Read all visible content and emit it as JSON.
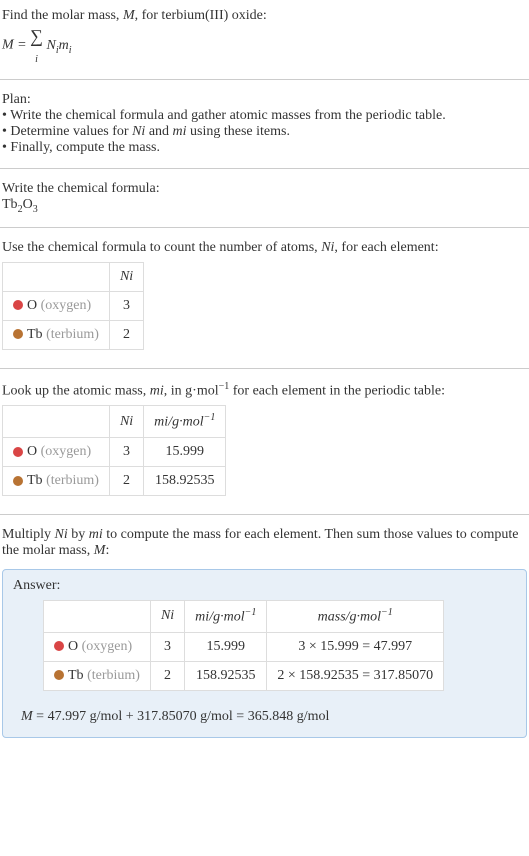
{
  "intro": {
    "line1": "Find the molar mass, ",
    "var_m": "M",
    "line1b": ", for terbium(III) oxide:",
    "formula_prefix": "M = ",
    "formula_body": "Nᵢmᵢ"
  },
  "plan": {
    "title": "Plan:",
    "bullet1": "• Write the chemical formula and gather atomic masses from the periodic table.",
    "bullet2_a": "• Determine values for ",
    "bullet2_ni": "Nᵢ",
    "bullet2_b": " and ",
    "bullet2_mi": "mᵢ",
    "bullet2_c": " using these items.",
    "bullet3": "• Finally, compute the mass."
  },
  "chem": {
    "title": "Write the chemical formula:",
    "formula_tb": "Tb",
    "formula_tb_sub": "2",
    "formula_o": "O",
    "formula_o_sub": "3"
  },
  "count": {
    "title_a": "Use the chemical formula to count the number of atoms, ",
    "title_ni": "Nᵢ",
    "title_b": ", for each element:",
    "header_ni": "Nᵢ",
    "rows": [
      {
        "sym": "O",
        "name": "(oxygen)",
        "n": "3"
      },
      {
        "sym": "Tb",
        "name": "(terbium)",
        "n": "2"
      }
    ]
  },
  "lookup": {
    "title_a": "Look up the atomic mass, ",
    "title_mi": "mᵢ",
    "title_b": ", in g·mol",
    "title_sup": "−1",
    "title_c": " for each element in the periodic table:",
    "header_ni": "Nᵢ",
    "header_mi_a": "mᵢ",
    "header_mi_b": "/g·mol",
    "header_mi_sup": "−1",
    "rows": [
      {
        "sym": "O",
        "name": "(oxygen)",
        "n": "3",
        "m": "15.999"
      },
      {
        "sym": "Tb",
        "name": "(terbium)",
        "n": "2",
        "m": "158.92535"
      }
    ]
  },
  "multiply": {
    "text_a": "Multiply ",
    "ni": "Nᵢ",
    "text_b": " by ",
    "mi": "mᵢ",
    "text_c": " to compute the mass for each element. Then sum those values to compute the molar mass, ",
    "mvar": "M",
    "text_d": ":"
  },
  "answer": {
    "label": "Answer:",
    "header_ni": "Nᵢ",
    "header_mi_a": "mᵢ",
    "header_mi_b": "/g·mol",
    "header_mi_sup": "−1",
    "header_mass_a": "mass/g·mol",
    "header_mass_sup": "−1",
    "rows": [
      {
        "sym": "O",
        "name": "(oxygen)",
        "n": "3",
        "m": "15.999",
        "calc": "3 × 15.999 = 47.997"
      },
      {
        "sym": "Tb",
        "name": "(terbium)",
        "n": "2",
        "m": "158.92535",
        "calc": "2 × 158.92535 = 317.85070"
      }
    ],
    "result_a": "M",
    "result_b": " = 47.997 g/mol + 317.85070 g/mol = 365.848 g/mol"
  }
}
